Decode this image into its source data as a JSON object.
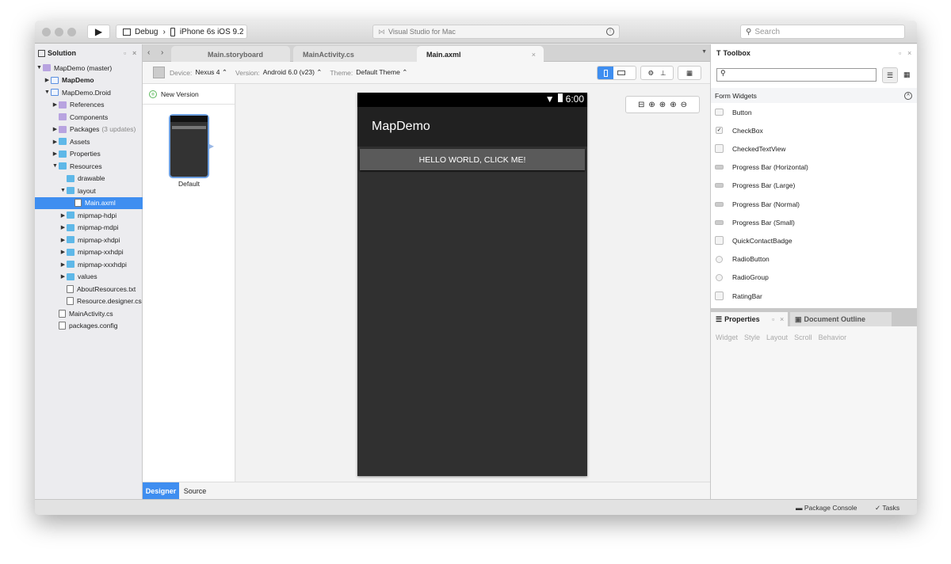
{
  "window": {
    "run_config": "Debug",
    "device": "iPhone 6s iOS 9.2",
    "title": "Visual Studio for Mac",
    "search_placeholder": "Search"
  },
  "solution": {
    "title": "Solution",
    "items": [
      {
        "label": "MapDemo (master)",
        "level": 0,
        "arrow": "down",
        "icon": "solution"
      },
      {
        "label": "MapDemo",
        "level": 1,
        "arrow": "right",
        "icon": "project",
        "bold": true
      },
      {
        "label": "MapDemo.Droid",
        "level": 1,
        "arrow": "down",
        "icon": "project"
      },
      {
        "label": "References",
        "level": 2,
        "arrow": "right",
        "icon": "special-folder"
      },
      {
        "label": "Components",
        "level": 2,
        "arrow": "",
        "icon": "special-folder"
      },
      {
        "label": "Packages",
        "extra": "(3 updates)",
        "level": 2,
        "arrow": "right",
        "icon": "special-folder"
      },
      {
        "label": "Assets",
        "level": 2,
        "arrow": "right",
        "icon": "folder"
      },
      {
        "label": "Properties",
        "level": 2,
        "arrow": "right",
        "icon": "folder"
      },
      {
        "label": "Resources",
        "level": 2,
        "arrow": "down",
        "icon": "folder"
      },
      {
        "label": "drawable",
        "level": 3,
        "arrow": "",
        "icon": "folder"
      },
      {
        "label": "layout",
        "level": 3,
        "arrow": "down",
        "icon": "folder"
      },
      {
        "label": "Main.axml",
        "level": 4,
        "arrow": "",
        "icon": "file",
        "selected": true
      },
      {
        "label": "mipmap-hdpi",
        "level": 3,
        "arrow": "right",
        "icon": "folder"
      },
      {
        "label": "mipmap-mdpi",
        "level": 3,
        "arrow": "right",
        "icon": "folder"
      },
      {
        "label": "mipmap-xhdpi",
        "level": 3,
        "arrow": "right",
        "icon": "folder"
      },
      {
        "label": "mipmap-xxhdpi",
        "level": 3,
        "arrow": "right",
        "icon": "folder"
      },
      {
        "label": "mipmap-xxxhdpi",
        "level": 3,
        "arrow": "right",
        "icon": "folder"
      },
      {
        "label": "values",
        "level": 3,
        "arrow": "right",
        "icon": "folder"
      },
      {
        "label": "AboutResources.txt",
        "level": 3,
        "arrow": "",
        "icon": "file"
      },
      {
        "label": "Resource.designer.cs",
        "level": 3,
        "arrow": "",
        "icon": "file"
      },
      {
        "label": "MainActivity.cs",
        "level": 2,
        "arrow": "",
        "icon": "file"
      },
      {
        "label": "packages.config",
        "level": 2,
        "arrow": "",
        "icon": "file"
      }
    ]
  },
  "tabs": [
    {
      "label": "Main.storyboard"
    },
    {
      "label": "MainActivity.cs"
    },
    {
      "label": "Main.axml",
      "active": true
    }
  ],
  "designer_toolbar": {
    "device_label": "Device:",
    "device": "Nexus 4",
    "version_label": "Version:",
    "version": "Android 6.0 (v23)",
    "theme_label": "Theme:",
    "theme": "Default Theme"
  },
  "versions": {
    "new_label": "New Version",
    "default_label": "Default"
  },
  "phone": {
    "time": "6:00",
    "app_title": "MapDemo",
    "button_text": "HELLO WORLD, CLICK ME!"
  },
  "bottom_tabs": [
    {
      "label": "Designer",
      "active": true
    },
    {
      "label": "Source"
    }
  ],
  "status": {
    "package_console": "Package Console",
    "tasks": "Tasks"
  },
  "toolbox": {
    "title": "Toolbox",
    "section": "Form Widgets",
    "items": [
      {
        "label": "Button",
        "icon": "button"
      },
      {
        "label": "CheckBox",
        "icon": "checkbox"
      },
      {
        "label": "CheckedTextView",
        "icon": "widget"
      },
      {
        "label": "Progress Bar (Horizontal)",
        "icon": "progress"
      },
      {
        "label": "Progress Bar (Large)",
        "icon": "progress"
      },
      {
        "label": "Progress Bar (Normal)",
        "icon": "progress"
      },
      {
        "label": "Progress Bar (Small)",
        "icon": "progress"
      },
      {
        "label": "QuickContactBadge",
        "icon": "widget"
      },
      {
        "label": "RadioButton",
        "icon": "radio"
      },
      {
        "label": "RadioGroup",
        "icon": "radio-group"
      },
      {
        "label": "RatingBar",
        "icon": "widget"
      }
    ]
  },
  "properties": {
    "title": "Properties",
    "outline_title": "Document Outline",
    "tabs": [
      "Widget",
      "Style",
      "Layout",
      "Scroll",
      "Behavior"
    ]
  },
  "colors": {
    "accent": "#3f8ef0",
    "phone_body": "#303030",
    "phone_appbar": "#212121",
    "phone_button": "#5a5a5a"
  }
}
